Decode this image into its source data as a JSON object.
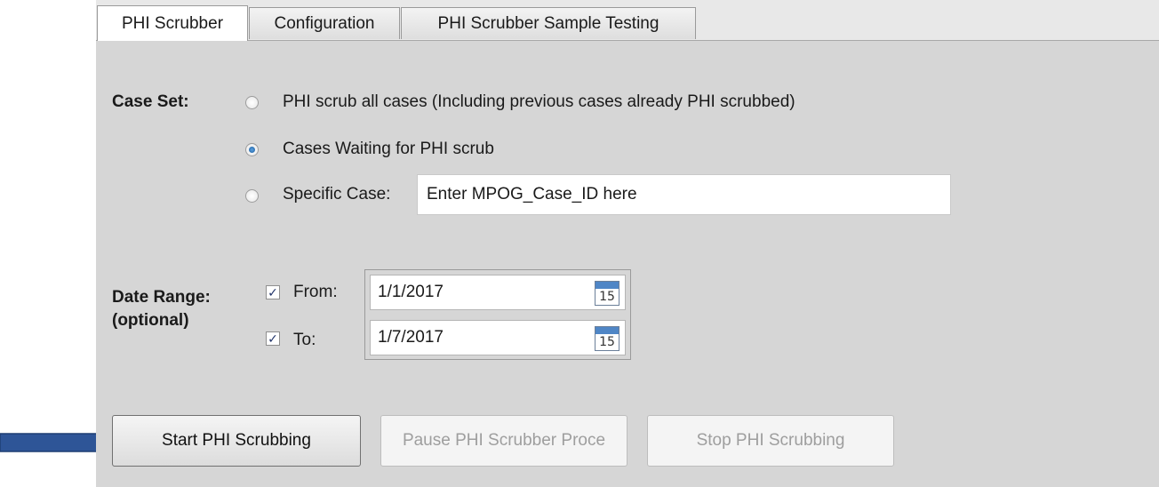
{
  "tabs": [
    {
      "label": "PHI Scrubber",
      "active": true
    },
    {
      "label": "Configuration",
      "active": false
    },
    {
      "label": "PHI Scrubber Sample Testing",
      "active": false
    }
  ],
  "case_set": {
    "label": "Case Set:",
    "options": [
      {
        "label": "PHI scrub all cases (Including previous cases already PHI scrubbed)",
        "selected": false
      },
      {
        "label": "Cases Waiting for PHI scrub",
        "selected": true
      },
      {
        "label": "Specific Case:",
        "selected": false
      }
    ],
    "specific_case_placeholder": "Enter MPOG_Case_ID here"
  },
  "date_range": {
    "label": "Date Range:",
    "sublabel": "(optional)",
    "from": {
      "label": "From:",
      "checked": true,
      "value": "1/1/2017"
    },
    "to": {
      "label": "To:",
      "checked": true,
      "value": "1/7/2017"
    },
    "calendar_day": "15"
  },
  "buttons": {
    "start": {
      "label": "Start PHI Scrubbing",
      "enabled": true
    },
    "pause": {
      "label": "Pause PHI Scrubber Proce",
      "enabled": false
    },
    "stop": {
      "label": "Stop PHI Scrubbing",
      "enabled": false
    }
  },
  "colors": {
    "accent_arrow": "#2e5597",
    "radio_selected": "#1d5e9e",
    "checkbox_mark": "#23356b"
  }
}
